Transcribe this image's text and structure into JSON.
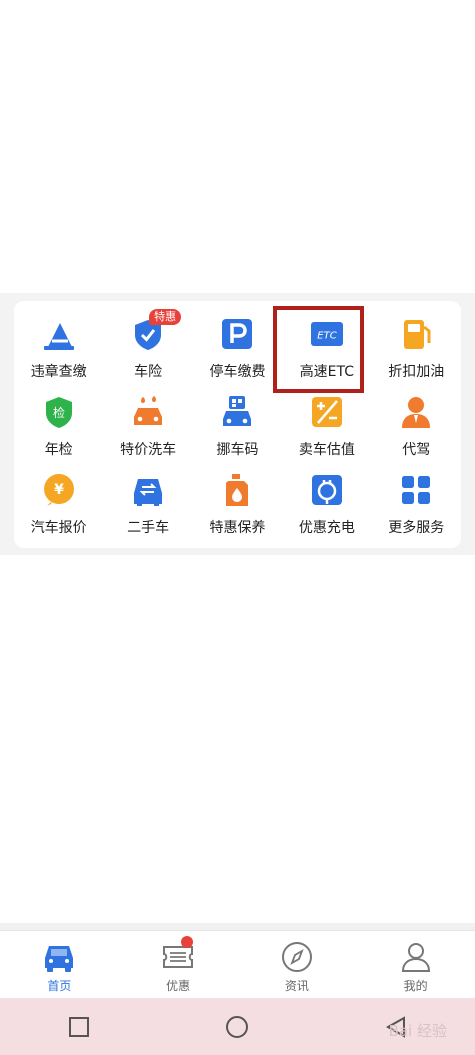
{
  "services": {
    "items": [
      {
        "label": "违章查缴",
        "icon": "cone-icon"
      },
      {
        "label": "车险",
        "icon": "shield-check-icon",
        "badge": "特惠"
      },
      {
        "label": "停车缴费",
        "icon": "parking-icon"
      },
      {
        "label": "高速ETC",
        "icon": "etc-icon",
        "icon_text": "ETC"
      },
      {
        "label": "折扣加油",
        "icon": "fuel-pump-icon"
      },
      {
        "label": "年检",
        "icon": "inspection-shield-icon",
        "icon_text": "检"
      },
      {
        "label": "特价洗车",
        "icon": "car-wash-icon"
      },
      {
        "label": "挪车码",
        "icon": "move-car-qr-icon"
      },
      {
        "label": "卖车估值",
        "icon": "calculator-icon"
      },
      {
        "label": "代驾",
        "icon": "driver-icon"
      },
      {
        "label": "汽车报价",
        "icon": "price-icon",
        "icon_text": "¥"
      },
      {
        "label": "二手车",
        "icon": "used-car-icon"
      },
      {
        "label": "特惠保养",
        "icon": "oil-can-icon"
      },
      {
        "label": "优惠充电",
        "icon": "charging-icon"
      },
      {
        "label": "更多服务",
        "icon": "grid-icon"
      }
    ]
  },
  "tabbar": {
    "tabs": [
      {
        "label": "首页",
        "icon": "car-icon",
        "active": true
      },
      {
        "label": "优惠",
        "icon": "coupon-icon"
      },
      {
        "label": "资讯",
        "icon": "compass-icon"
      },
      {
        "label": "我的",
        "icon": "user-icon"
      }
    ]
  },
  "watermark": "Bai 经验",
  "colors": {
    "accent": "#2f73e0",
    "orange": "#f07a2e",
    "green": "#2eb24a",
    "red": "#e8413a",
    "highlight": "#b0211c"
  }
}
